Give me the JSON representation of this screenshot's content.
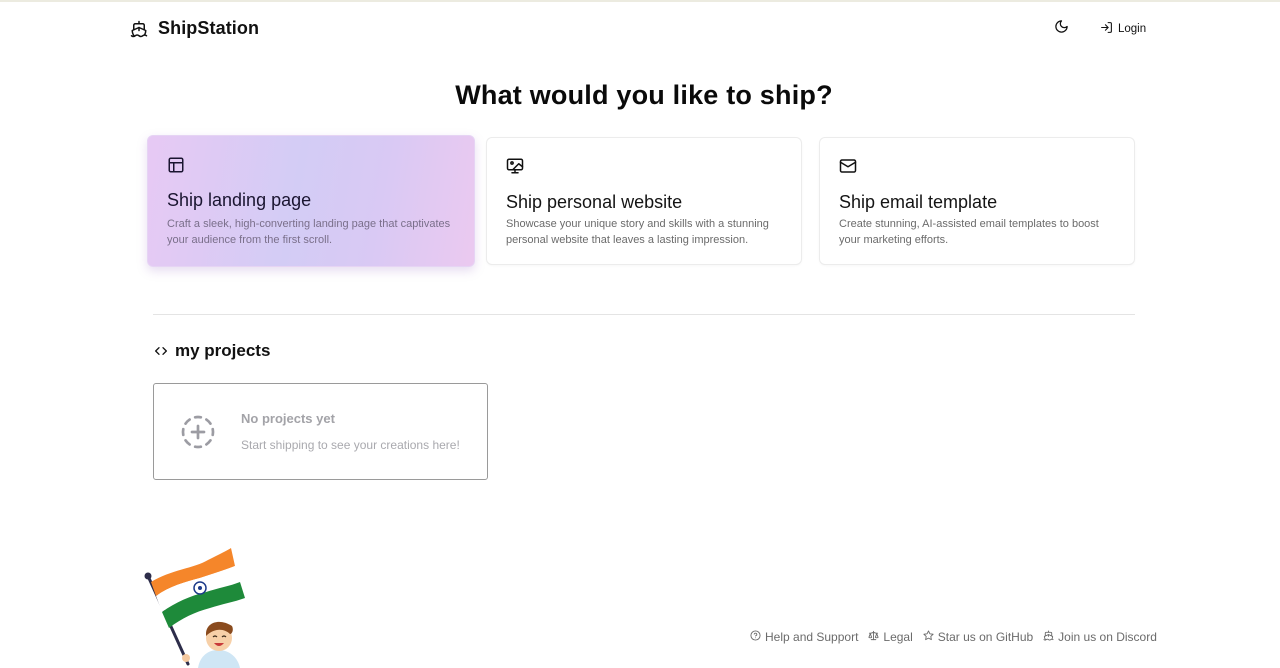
{
  "header": {
    "brand_name": "ShipStation",
    "brand_icon": "ship-icon",
    "theme_toggle_icon": "moon-icon",
    "login_label": "Login",
    "login_icon": "log-in-icon"
  },
  "main": {
    "title": "What would you like to ship?",
    "cards": [
      {
        "icon": "layout-icon",
        "title": "Ship landing page",
        "description": "Craft a sleek, high-converting landing page that captivates your audience from the first scroll.",
        "selected": true
      },
      {
        "icon": "image-monitor-icon",
        "title": "Ship personal website",
        "description": "Showcase your unique story and skills with a stunning personal website that leaves a lasting impression.",
        "selected": false
      },
      {
        "icon": "mail-icon",
        "title": "Ship email template",
        "description": "Create stunning, AI-assisted email templates to boost your marketing efforts.",
        "selected": false
      }
    ]
  },
  "projects": {
    "heading_icon": "code-icon",
    "heading": "my projects",
    "empty_state": {
      "icon": "circle-dashed-plus-icon",
      "title": "No projects yet",
      "subtitle": "Start shipping to see your creations here!"
    }
  },
  "mascot": {
    "description": "boy-waving-indian-flag-illustration"
  },
  "footer": {
    "links": [
      {
        "icon": "help-circle-icon",
        "label": "Help and Support"
      },
      {
        "icon": "scale-icon",
        "label": "Legal"
      },
      {
        "icon": "star-icon",
        "label": "Star us on GitHub"
      },
      {
        "icon": "discord-icon",
        "label": "Join us on Discord"
      }
    ]
  },
  "colors": {
    "card_selected_gradient_start": "#e7c9f4",
    "card_selected_gradient_mid": "#d3ccf5",
    "card_selected_gradient_end": "#ebc9f0",
    "text_primary": "#0a0a0a",
    "text_muted": "#6b6b6b"
  }
}
